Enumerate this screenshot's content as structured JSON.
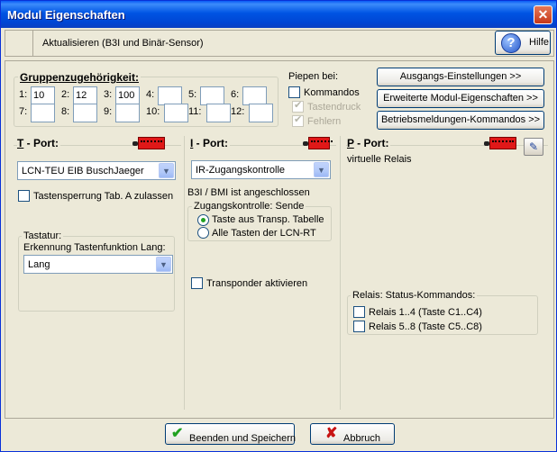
{
  "window": {
    "title": "Modul Eigenschaften",
    "close_glyph": "✕"
  },
  "toolbar": {
    "label": "Aktualisieren (B3I und Binär-Sensor)",
    "help_label": "Hilfe",
    "help_glyph": "?"
  },
  "groups": {
    "title": "Gruppenzugehörigkeit:",
    "slots": [
      {
        "label": "1:",
        "value": "10"
      },
      {
        "label": "2:",
        "value": "12"
      },
      {
        "label": "3:",
        "value": "100"
      },
      {
        "label": "4:",
        "value": ""
      },
      {
        "label": "5:",
        "value": ""
      },
      {
        "label": "6:",
        "value": ""
      },
      {
        "label": "7:",
        "value": ""
      },
      {
        "label": "8:",
        "value": ""
      },
      {
        "label": "9:",
        "value": ""
      },
      {
        "label": "10:",
        "value": ""
      },
      {
        "label": "11:",
        "value": ""
      },
      {
        "label": "12:",
        "value": ""
      }
    ]
  },
  "beep": {
    "title": "Piepen bei:",
    "kommandos": "Kommandos",
    "tastendruck": "Tastendruck",
    "fehlern": "Fehlern"
  },
  "actions": {
    "ausgangs": "Ausgangs-Einstellungen >>",
    "erweitert": "Erweiterte Modul-Eigenschaften >>",
    "betrieb": "Betriebsmeldungen-Kommandos >>"
  },
  "t_port": {
    "title_prefix": "T",
    "title_suffix": " - Port:",
    "select_value": "LCN-TEU EIB BuschJaeger",
    "lock_label": "Tastensperrung Tab. A zulassen",
    "tastatur_title": "Tastatur:",
    "key_function_label": "Erkennung Tastenfunktion Lang:",
    "key_function_value": "Lang"
  },
  "i_port": {
    "title_prefix": "I",
    "title_suffix": " - Port:",
    "select_value": "IR-Zugangskontrolle",
    "connected_text": "B3I / BMI ist angeschlossen",
    "access_title": "Zugangskontrolle: Sende",
    "option_transp": "Taste aus Transp. Tabelle",
    "option_all": "Alle Tasten der LCN-RT",
    "transponder_label": "Transponder aktivieren"
  },
  "p_port": {
    "title_prefix": "P",
    "title_suffix": " - Port:",
    "subtitle": "virtuelle Relais",
    "relais_title": "Relais: Status-Kommandos:",
    "relais_1_4": "Relais 1..4 (Taste C1..C4)",
    "relais_5_8": "Relais 5..8 (Taste C5..C8)"
  },
  "footer": {
    "save_label": "Beenden und Speichern",
    "cancel_label": "Abbruch"
  },
  "icons": {
    "check": "check-icon",
    "cross": "cross-icon",
    "help": "help-icon",
    "edit": "edit-icon",
    "port": "connector-icon"
  },
  "colors": {
    "titlebar": "#0054E3",
    "window_bg": "#ECE9D8",
    "port_icon": "#E01818",
    "check_green": "#21A121",
    "cancel_red": "#C81414"
  }
}
